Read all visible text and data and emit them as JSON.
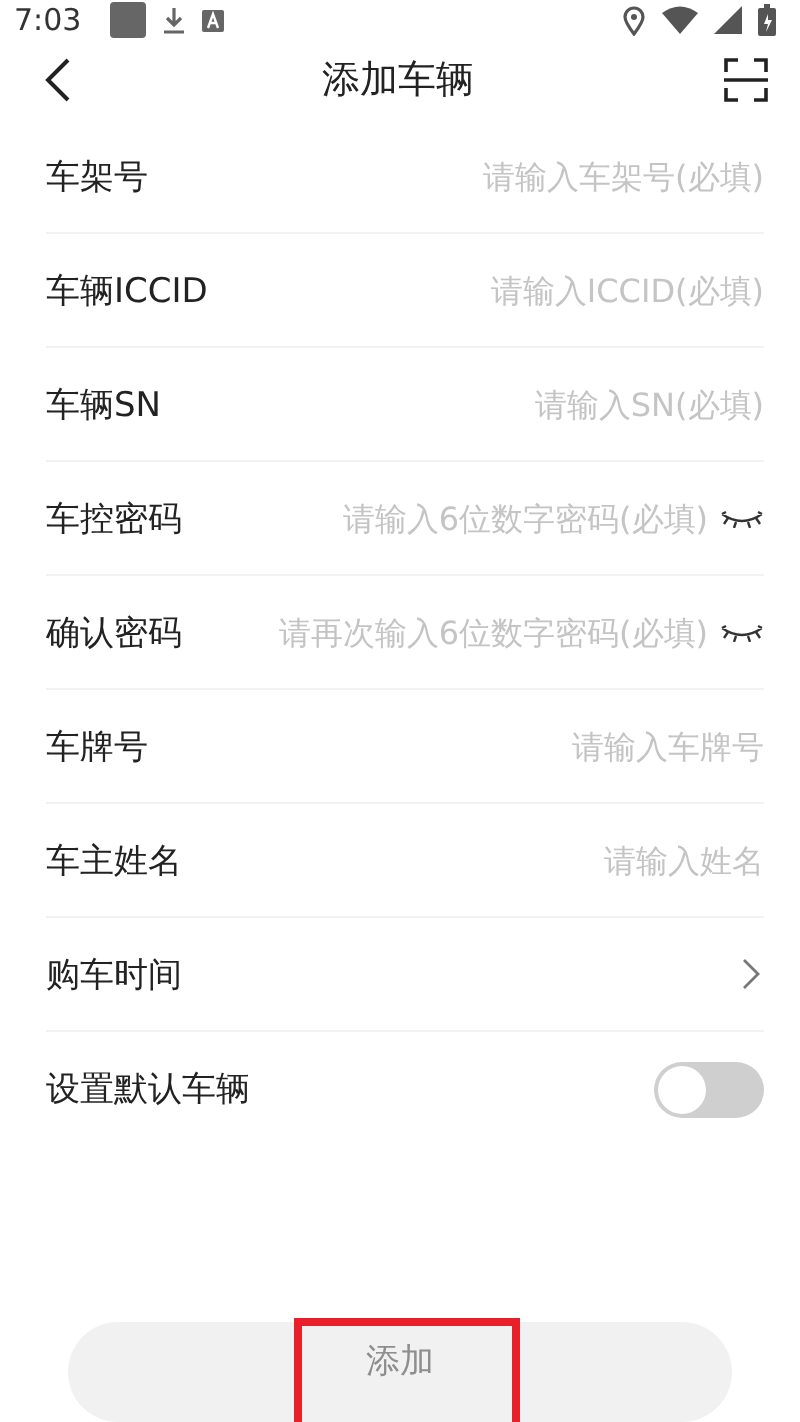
{
  "status_bar": {
    "time": "7:03"
  },
  "header": {
    "title": "添加车辆"
  },
  "form": [
    {
      "kind": "input",
      "label": "车架号",
      "placeholder": "请输入车架号(必填)"
    },
    {
      "kind": "input",
      "label": "车辆ICCID",
      "placeholder": "请输入ICCID(必填)"
    },
    {
      "kind": "input",
      "label": "车辆SN",
      "placeholder": "请输入SN(必填)"
    },
    {
      "kind": "password",
      "label": "车控密码",
      "placeholder": "请输入6位数字密码(必填)"
    },
    {
      "kind": "password",
      "label": "确认密码",
      "placeholder": "请再次输入6位数字密码(必填)"
    },
    {
      "kind": "input",
      "label": "车牌号",
      "placeholder": "请输入车牌号"
    },
    {
      "kind": "input",
      "label": "车主姓名",
      "placeholder": "请输入姓名"
    },
    {
      "kind": "select",
      "label": "购车时间"
    },
    {
      "kind": "toggle",
      "label": "设置默认车辆",
      "on": false
    }
  ],
  "submit_button": {
    "label": "添加",
    "disabled": true
  }
}
